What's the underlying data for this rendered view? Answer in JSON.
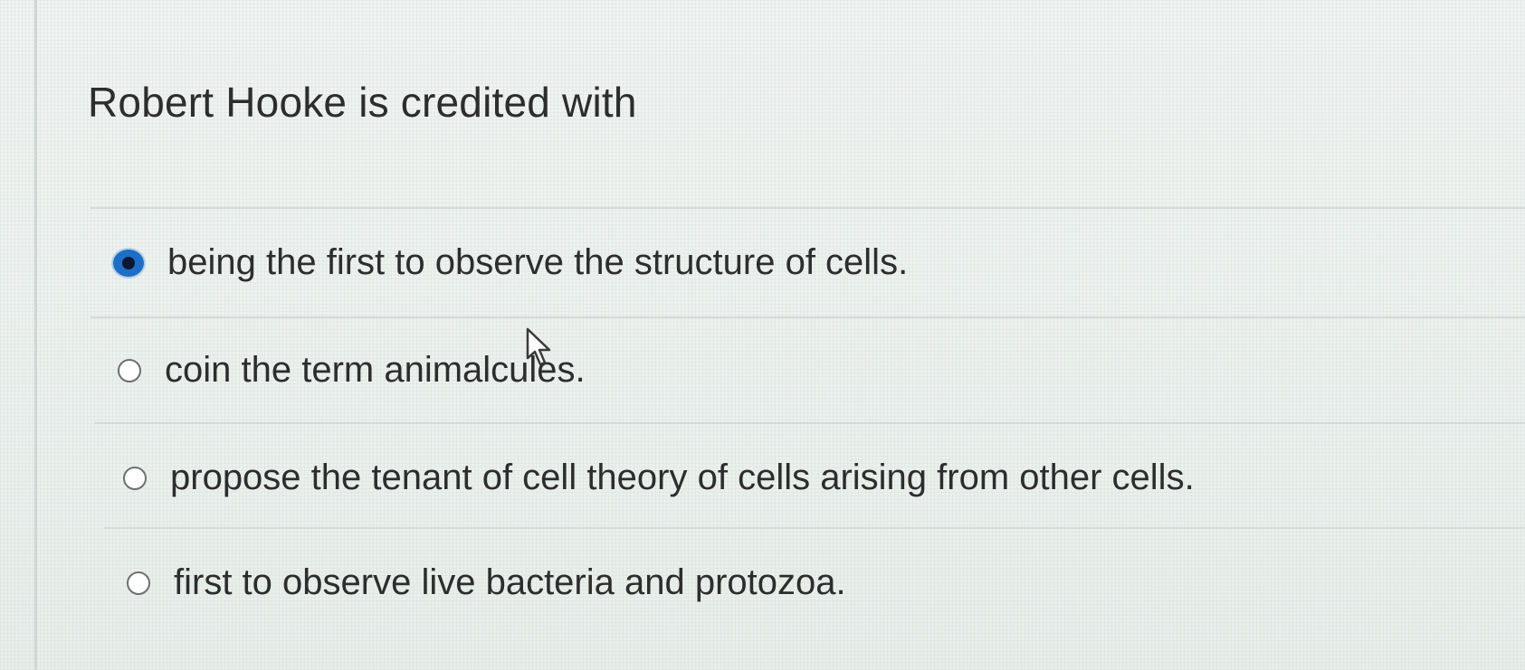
{
  "question": {
    "text": "Robert Hooke is credited with"
  },
  "options": [
    {
      "label": "being the first to observe the structure of cells.",
      "selected": true
    },
    {
      "label": "coin the term animalcules.",
      "selected": false
    },
    {
      "label": "propose the tenant of cell theory of cells arising from other cells.",
      "selected": false
    },
    {
      "label": "first to observe live bacteria and protozoa.",
      "selected": false
    }
  ],
  "colors": {
    "accent": "#1d6fc6",
    "text": "#2d2d2d",
    "divider": "#d2dbd8"
  },
  "icons": {
    "pointer": "mouse-pointer-icon"
  }
}
